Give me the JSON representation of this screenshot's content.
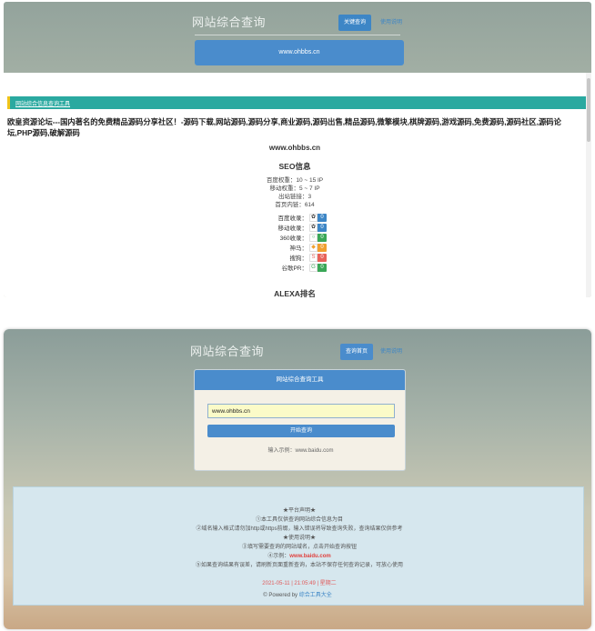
{
  "colors": {
    "accent": "#4a8ccc",
    "teal": "#2aa9a0",
    "badge_blue": "#3d86c6",
    "badge_green": "#3aa757",
    "badge_orange": "#f0a030",
    "badge_red": "#e8625a"
  },
  "top": {
    "header": {
      "brand": "网站综合查询",
      "nav_active": "关键查询",
      "nav_link": "使用说明"
    },
    "domain_bar": "www.ohbbs.cn",
    "teal_link": "网站综合信息查询工具",
    "description": "欧皇资源论坛---国内著名的免费精品源码分享社区！-源码下载,网站源码,源码分享,商业源码,源码出售,精品源码,微擎模块,棋牌源码,游戏源码,免费源码,源码社区,源码论坛,PHP源码,破解源码",
    "site": "www.ohbbs.cn",
    "seo_title": "SEO信息",
    "seo_rows": [
      "百度权重：10 ~ 15 IP",
      "移动权重：5 ~ 7 IP",
      "出站链接：3",
      "首页内链：614"
    ],
    "index_rows": [
      {
        "label": "百度收录：",
        "icon": "baidu-icon",
        "value": "0",
        "color": "#3d86c6"
      },
      {
        "label": "移动收录：",
        "icon": "baidu-mobile-icon",
        "value": "0",
        "color": "#3d86c6"
      },
      {
        "label": "360收录：",
        "icon": "so360-icon",
        "value": "0",
        "color": "#3aa757"
      },
      {
        "label": "神马：",
        "icon": "shenma-icon",
        "value": "0",
        "color": "#f0a030"
      },
      {
        "label": "搜狗：",
        "icon": "sogou-icon",
        "value": "0",
        "color": "#e8625a"
      },
      {
        "label": "谷歌PR：",
        "icon": "google-icon",
        "value": "0",
        "color": "#3aa757"
      }
    ],
    "alexa_title": "ALEXA排名"
  },
  "bottom": {
    "header": {
      "brand": "网站综合查询",
      "nav_active": "查询首页",
      "nav_link": "使用说明"
    },
    "card": {
      "title": "网站综合查询工具",
      "input_value": "www.ohbbs.cn",
      "button": "开始查询",
      "hint": "输入示例：www.baidu.com"
    },
    "notice": {
      "heading": "★平台声明★",
      "line1": "①本工具仅供查询网站综合信息为目",
      "line2": "②域名输入格式请勿加http或https前缀，输入错误将导致查询失败，查询结果仅供参考",
      "heading2": "★使用说明★",
      "line3": "③填写需要查询的网站域名，点击开始查询按钮",
      "line4_prefix": "④示例：",
      "line4_value": "www.baidu.com",
      "line5": "⑤如果查询结果有误差，请刷新页面重新查询，本站不保存任何查询记录，可放心使用",
      "date": "2021-05-11 | 21:05:49 | 星期二"
    },
    "footer": {
      "prefix": "© Powered by ",
      "link": "综合工具大全"
    }
  }
}
